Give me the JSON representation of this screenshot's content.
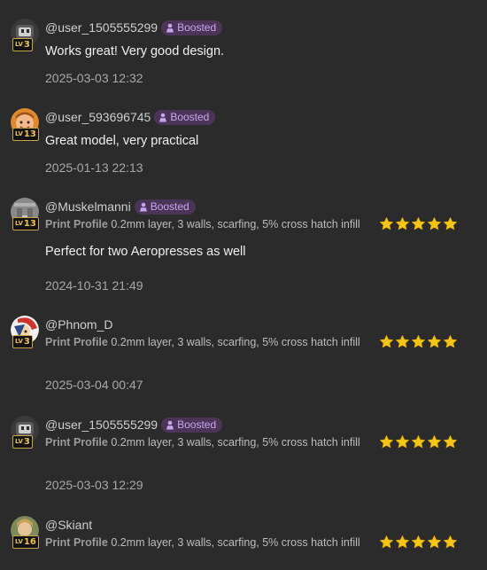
{
  "boosted_label": "Boosted",
  "print_profile_label": "Print Profile",
  "colors": {
    "background": "#2b2b2b",
    "boost_bg": "#4a3558",
    "star": "#f5c518",
    "level": "#f1c24a"
  },
  "comments": [
    {
      "username": "@user_1505555299",
      "level": "3",
      "boosted": true,
      "text": "Works great! Very good design.",
      "timestamp": "2025-03-03 12:32",
      "avatar_icon": "robot-avatar-icon"
    },
    {
      "username": "@user_593696745",
      "level": "13",
      "boosted": true,
      "text": "Great model, very practical",
      "timestamp": "2025-01-13 22:13",
      "avatar_icon": "cartoon-face-avatar-icon"
    },
    {
      "username": "@Muskelmanni",
      "level": "13",
      "boosted": true,
      "profile": "0.2mm layer, 3 walls, scarfing, 5% cross hatch infill",
      "rating": 5,
      "text": "Perfect for two Aeropresses as well",
      "timestamp": "2024-10-31 21:49",
      "avatar_icon": "photo-avatar-icon"
    },
    {
      "username": "@Phnom_D",
      "level": "3",
      "boosted": false,
      "profile": "0.2mm layer, 3 walls, scarfing, 5% cross hatch infill",
      "rating": 5,
      "text": "",
      "timestamp": "2025-03-04 00:47",
      "avatar_icon": "character-avatar-icon"
    },
    {
      "username": "@user_1505555299",
      "level": "3",
      "boosted": true,
      "profile": "0.2mm layer, 3 walls, scarfing, 5% cross hatch infill",
      "rating": 5,
      "text": "",
      "timestamp": "2025-03-03 12:29",
      "avatar_icon": "robot-avatar-icon"
    },
    {
      "username": "@Skiant",
      "level": "16",
      "boosted": false,
      "profile": "0.2mm layer, 3 walls, scarfing, 5% cross hatch infill",
      "rating": 5,
      "text": "",
      "timestamp": "",
      "avatar_icon": "photo-avatar-icon"
    }
  ]
}
